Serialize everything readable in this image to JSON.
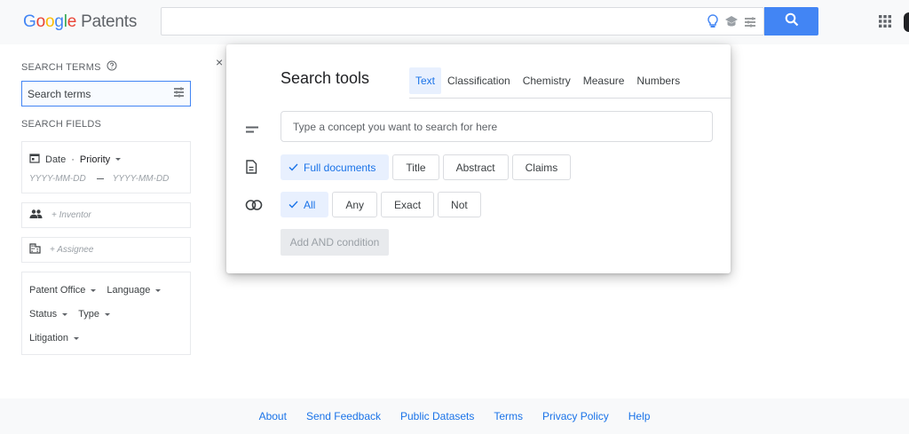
{
  "header": {
    "logo_letters": [
      "G",
      "o",
      "o",
      "g",
      "l",
      "e"
    ],
    "product": "Patents",
    "search_value": "",
    "icons": [
      "lightbulb-icon",
      "graduation-cap-icon",
      "tune-icon",
      "search-icon",
      "apps-grid-icon"
    ]
  },
  "left": {
    "search_terms_label": "SEARCH TERMS",
    "search_terms_placeholder": "Search terms",
    "search_fields_label": "SEARCH FIELDS",
    "date_label": "Date",
    "date_sep": "·",
    "date_type": "Priority",
    "date_from_placeholder": "YYYY-MM-DD",
    "date_to_placeholder": "YYYY-MM-DD",
    "inventor": "+ Inventor",
    "assignee": "+ Assignee",
    "filters": {
      "patent_office": "Patent Office",
      "language": "Language",
      "status": "Status",
      "type": "Type",
      "litigation": "Litigation"
    }
  },
  "modal": {
    "close": "×",
    "title": "Search tools",
    "tabs": [
      {
        "label": "Text",
        "active": true
      },
      {
        "label": "Classification",
        "active": false
      },
      {
        "label": "Chemistry",
        "active": false
      },
      {
        "label": "Measure",
        "active": false
      },
      {
        "label": "Numbers",
        "active": false
      }
    ],
    "concept_placeholder": "Type a concept you want to search for here",
    "scope": [
      {
        "label": "Full documents",
        "selected": true
      },
      {
        "label": "Title",
        "selected": false
      },
      {
        "label": "Abstract",
        "selected": false
      },
      {
        "label": "Claims",
        "selected": false
      }
    ],
    "match": [
      {
        "label": "All",
        "selected": true
      },
      {
        "label": "Any",
        "selected": false
      },
      {
        "label": "Exact",
        "selected": false
      },
      {
        "label": "Not",
        "selected": false
      }
    ],
    "add_condition": "Add AND condition"
  },
  "footer": {
    "links": [
      "About",
      "Send Feedback",
      "Public Datasets",
      "Terms",
      "Privacy Policy",
      "Help"
    ]
  },
  "colors": {
    "accent": "#4285f4",
    "link": "#1a73e8",
    "selected_bg": "#e8f0fe"
  }
}
